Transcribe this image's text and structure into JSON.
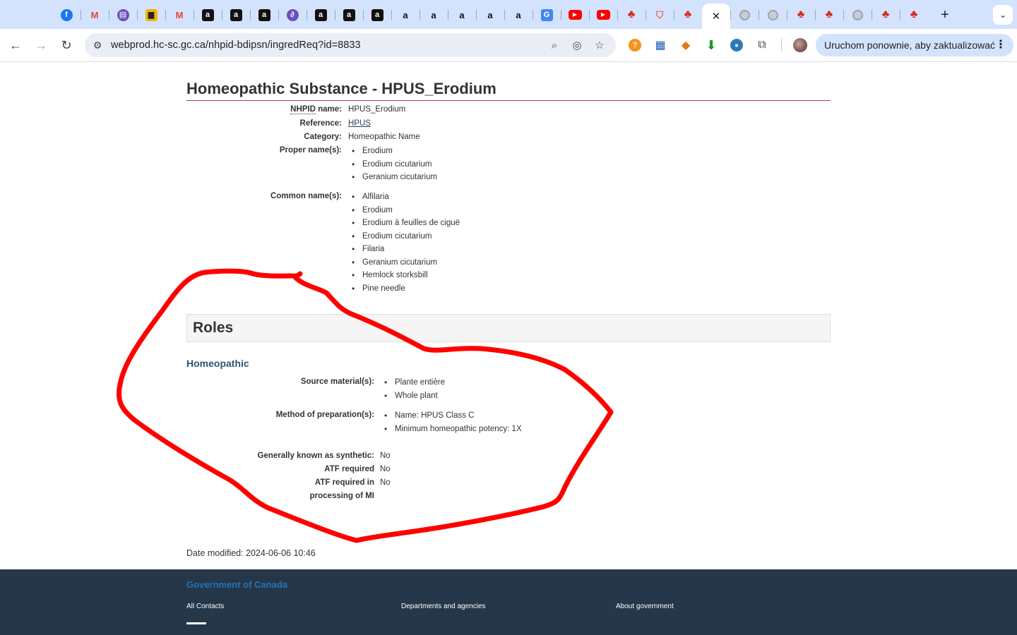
{
  "browser": {
    "tabs": [
      {
        "icon": "facebook-icon",
        "glyph": "f",
        "cls": "fav-fb"
      },
      {
        "icon": "gmail-icon",
        "glyph": "M",
        "cls": "fav-gm"
      },
      {
        "icon": "clipboard-icon",
        "glyph": "▤",
        "cls": "fav-gen"
      },
      {
        "icon": "shopping-bag-icon",
        "glyph": "▆",
        "cls": "fav-bag"
      },
      {
        "icon": "gmail-icon",
        "glyph": "M",
        "cls": "fav-gm"
      },
      {
        "icon": "amazon-icon",
        "glyph": "a",
        "cls": "fav-amz"
      },
      {
        "icon": "amazon-icon",
        "glyph": "a",
        "cls": "fav-amz"
      },
      {
        "icon": "amazon-icon",
        "glyph": "a",
        "cls": "fav-amz"
      },
      {
        "icon": "pen-icon",
        "glyph": "∂",
        "cls": "fav-gen"
      },
      {
        "icon": "amazon-icon",
        "glyph": "a",
        "cls": "fav-amz"
      },
      {
        "icon": "amazon-icon",
        "glyph": "a",
        "cls": "fav-amz"
      },
      {
        "icon": "amazon-icon",
        "glyph": "a",
        "cls": "fav-amz"
      },
      {
        "icon": "amazon-smile-icon",
        "glyph": "a",
        "cls": "fav-amz2"
      },
      {
        "icon": "amazon-smile-icon",
        "glyph": "a",
        "cls": "fav-amz2"
      },
      {
        "icon": "amazon-smile-icon",
        "glyph": "a",
        "cls": "fav-amz2"
      },
      {
        "icon": "amazon-smile-icon",
        "glyph": "a",
        "cls": "fav-amz2"
      },
      {
        "icon": "amazon-smile-icon",
        "glyph": "a",
        "cls": "fav-amz2"
      },
      {
        "icon": "google-translate-icon",
        "glyph": "G",
        "cls": "fav-tr"
      },
      {
        "icon": "youtube-icon",
        "glyph": "▶",
        "cls": "fav-yt"
      },
      {
        "icon": "youtube-icon",
        "glyph": "▶",
        "cls": "fav-yt"
      },
      {
        "icon": "canada-leaf-icon",
        "glyph": "♣",
        "cls": "fav-leaf"
      },
      {
        "icon": "shield-icon",
        "glyph": "⛉",
        "cls": "fav-shield"
      },
      {
        "icon": "canada-leaf-icon",
        "glyph": "♣",
        "cls": "fav-leaf"
      },
      {
        "icon": "close-tab-icon",
        "glyph": "✕",
        "cls": "active"
      },
      {
        "icon": "globe-icon",
        "glyph": "",
        "cls": "fav-globe"
      },
      {
        "icon": "globe-icon",
        "glyph": "",
        "cls": "fav-globe"
      },
      {
        "icon": "canada-leaf-icon",
        "glyph": "♣",
        "cls": "fav-leaf"
      },
      {
        "icon": "canada-leaf-icon",
        "glyph": "♣",
        "cls": "fav-leaf"
      },
      {
        "icon": "globe-icon",
        "glyph": "",
        "cls": "fav-globe"
      },
      {
        "icon": "canada-leaf-icon",
        "glyph": "♣",
        "cls": "fav-leaf"
      },
      {
        "icon": "canada-leaf-icon",
        "glyph": "♣",
        "cls": "fav-leaf"
      }
    ],
    "url_host": "webprod.hc-sc.gc.ca",
    "url_path": "/nhpid-bdipsn/ingredReq?id=8833",
    "update_button": "Uruchom ponownie, aby zaktualizować",
    "new_tab_glyph": "+",
    "tab_menu_glyph": "⌄"
  },
  "page": {
    "title": "Homeopathic Substance - HPUS_Erodium",
    "nhpid_label_abbr": "NHPID",
    "nhpid_label_rest": " name:",
    "nhpid_value": "HPUS_Erodium",
    "reference_label": "Reference:",
    "reference_value": "HPUS",
    "category_label": "Category:",
    "category_value": "Homeopathic Name",
    "proper_names_label": "Proper name(s):",
    "proper_names": [
      "Erodium",
      "Erodium cicutarium",
      "Geranium cicutarium"
    ],
    "common_names_label": "Common name(s):",
    "common_names": [
      "Alfilaria",
      "Erodium",
      "Erodium à feuilles de ciguë",
      "Erodium cicutarium",
      "Filaria",
      "Geranium cicutarium",
      "Hemlock storksbill",
      "Pine needle"
    ],
    "roles_heading": "Roles",
    "role_name": "Homeopathic",
    "source_material_label": "Source material(s):",
    "source_materials": [
      "Plante entière",
      "Whole plant"
    ],
    "method_label": "Method of preparation(s):",
    "methods": [
      "Name: HPUS Class C",
      "Minimum homeopathic potency: 1X"
    ],
    "synthetic_label": "Generally known as synthetic:",
    "synthetic_value": "No",
    "atf_label": "ATF required",
    "atf_value": "No",
    "atf_processing_label_1": "ATF required in",
    "atf_processing_label_2": "processing of MI",
    "atf_processing_value": "No",
    "date_modified": "Date modified: 2024-06-06 10:46"
  },
  "footer": {
    "government": "Government of Canada",
    "links": [
      "All Contacts",
      "Departments and agencies",
      "About government"
    ]
  },
  "colors": {
    "tabstrip": "#d3e3fd",
    "rule": "#af3c43",
    "role_heading": "#295376",
    "footer_bg": "#26374a",
    "annotation": "#ff0000"
  }
}
